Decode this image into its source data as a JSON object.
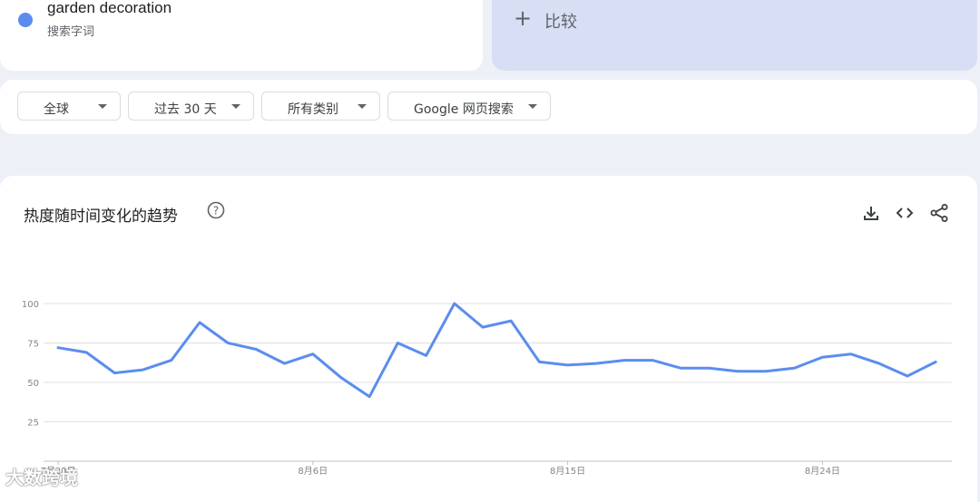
{
  "search_term": {
    "name": "garden decoration",
    "subtitle": "搜索字词",
    "color": "#5b8def"
  },
  "compare": {
    "label": "比较",
    "icon": "plus-icon"
  },
  "filters": [
    {
      "label": "全球"
    },
    {
      "label": "过去 30 天"
    },
    {
      "label": "所有类别"
    },
    {
      "label": "Google 网页搜索"
    }
  ],
  "chart_section": {
    "title": "热度随时间变化的趋势",
    "help_icon": "help-circle-icon",
    "tools": [
      "download-icon",
      "embed-code-icon",
      "share-icon"
    ]
  },
  "chart_data": {
    "type": "line",
    "x": [
      "7月28日",
      "7月29日",
      "7月30日",
      "7月31日",
      "8月1日",
      "8月2日",
      "8月3日",
      "8月4日",
      "8月5日",
      "8月6日",
      "8月7日",
      "8月8日",
      "8月9日",
      "8月10日",
      "8月11日",
      "8月12日",
      "8月13日",
      "8月14日",
      "8月15日",
      "8月16日",
      "8月17日",
      "8月18日",
      "8月19日",
      "8月20日",
      "8月21日",
      "8月22日",
      "8月23日",
      "8月24日",
      "8月25日",
      "8月26日",
      "8月27日",
      "8月28日",
      "8月29日"
    ],
    "series": [
      {
        "name": "garden decoration",
        "color": "#5b8def",
        "values": [
          72,
          69,
          56,
          58,
          64,
          88,
          75,
          71,
          62,
          68,
          53,
          41,
          75,
          67,
          100,
          85,
          89,
          63,
          61,
          62,
          64,
          64,
          59,
          59,
          57,
          57,
          59,
          66,
          68,
          62,
          54,
          63
        ]
      }
    ],
    "x_tick_labels": [
      "7月28日",
      "8月6日",
      "8月15日",
      "8月24日"
    ],
    "yticks": [
      25,
      50,
      75,
      100
    ],
    "ylim": [
      0,
      100
    ],
    "grid": true,
    "line_color": "#5b8def"
  },
  "watermark": "大数跨境"
}
